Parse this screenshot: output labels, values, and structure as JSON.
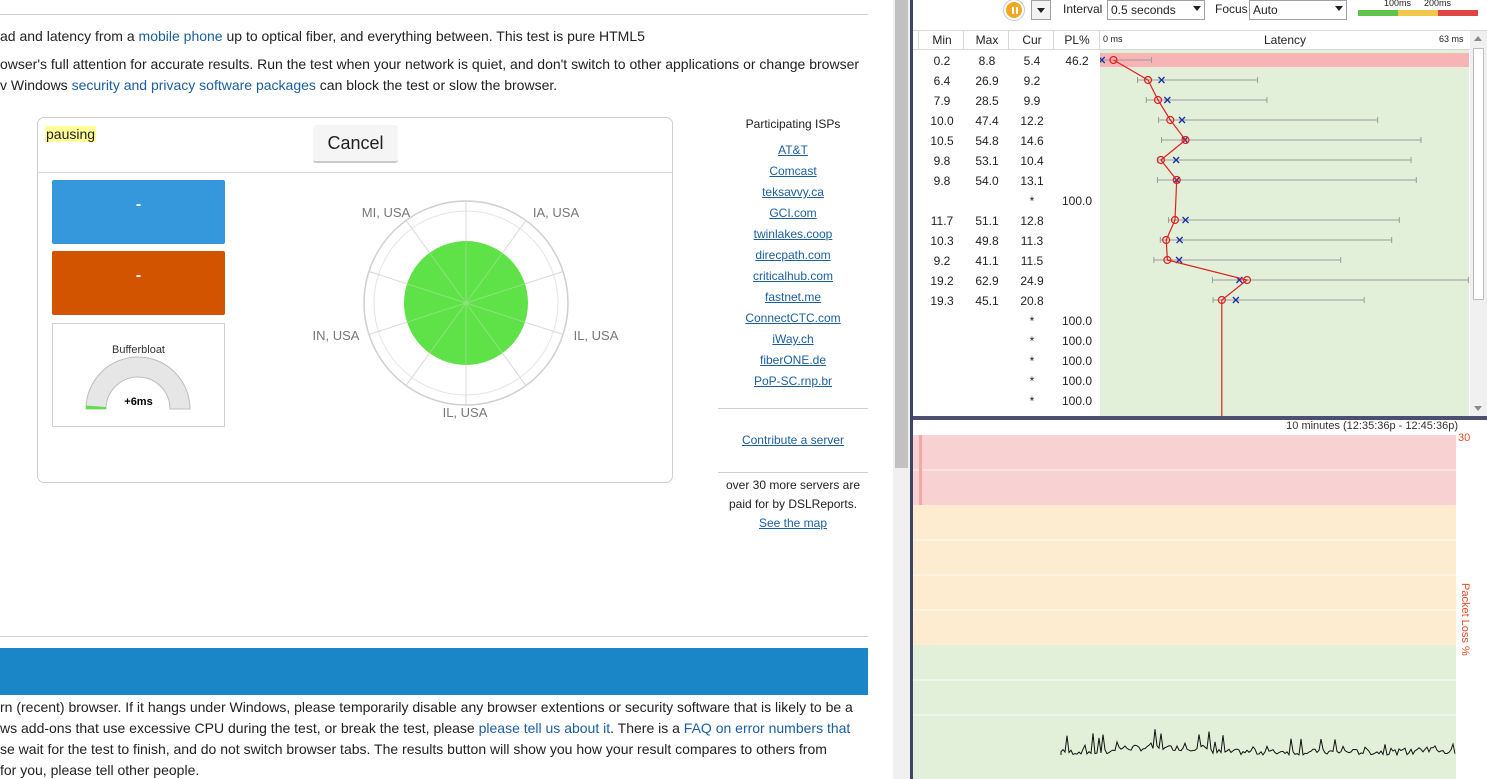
{
  "page": {
    "line1_parts": [
      "ad and latency from a ",
      "mobile phone",
      " up to optical fiber, and everything between. This test is pure HTML5"
    ],
    "line2": "owser's full attention for accurate results. Run the test when your network is quiet, and don't switch to other applications or change browser",
    "line3_parts": [
      "v Windows ",
      "security and privacy software packages",
      " can block the test or slow the browser."
    ],
    "bottom_lines": [
      [
        "rn (recent) browser. If it hangs under Windows, please temporarily disable any browser extentions or security software that is likely to be a"
      ],
      [
        "ws add-ons that use excessive CPU during the test, or break the test, please ",
        "please tell us about it",
        ". There is a ",
        "FAQ on error numbers that"
      ],
      [
        "se wait for the test to finish, and do not switch browser tabs. The results button will show you how your result compares to others from"
      ],
      [
        " for you, please tell other people."
      ]
    ]
  },
  "widget": {
    "status": "pausing",
    "cancel_label": "Cancel",
    "download_value": "-",
    "upload_value": "-",
    "bufferbloat_title": "Bufferbloat",
    "bufferbloat_value": "+6ms",
    "locations": [
      "MI, USA",
      "IA, USA",
      "IN, USA",
      "IL, USA",
      "IL, USA"
    ],
    "colors": {
      "download": "#3598dc",
      "upload": "#d35400",
      "radar_fill": "#5ee248"
    }
  },
  "isps": {
    "title": "Participating ISPs",
    "items": [
      "AT&T",
      "Comcast",
      "teksavvy.ca",
      "GCI.com",
      "twinlakes.coop",
      "direcpath.com",
      "criticalhub.com",
      "fastnet.me",
      "ConnectCTC.com",
      "iWay.ch",
      "fiberONE.de",
      "PoP-SC.rnp.br"
    ],
    "contribute": "Contribute a server",
    "note_lines": [
      "over 30 more servers are",
      "paid for by DSLReports."
    ],
    "see_map": "See the map"
  },
  "monitor": {
    "interval_label": "Interval",
    "interval_value": "0.5 seconds",
    "focus_label": "Focus",
    "focus_value": "Auto",
    "scale_labels": [
      "100ms",
      "200ms"
    ],
    "columns": {
      "min": "Min",
      "max": "Max",
      "cur": "Cur",
      "pl": "PL%",
      "latency": "Latency"
    },
    "axis_min": "0 ms",
    "axis_max": "63 ms",
    "range_label": "10 minutes (12:35:36p - 12:45:36p)",
    "pl_max": "30",
    "pl_axis": "Packet Loss %",
    "rows": [
      {
        "min": "0.2",
        "max": "8.8",
        "cur": "5.4",
        "pl": "46.2",
        "avg": 0.3,
        "cur_v": 2.3
      },
      {
        "min": "6.4",
        "max": "26.9",
        "cur": "9.2",
        "pl": "",
        "avg": 10.5,
        "cur_v": 8.2
      },
      {
        "min": "7.9",
        "max": "28.5",
        "cur": "9.9",
        "pl": "",
        "avg": 11.5,
        "cur_v": 9.9
      },
      {
        "min": "10.0",
        "max": "47.4",
        "cur": "12.2",
        "pl": "",
        "avg": 14.0,
        "cur_v": 12.0
      },
      {
        "min": "10.5",
        "max": "54.8",
        "cur": "14.6",
        "pl": "",
        "avg": 14.5,
        "cur_v": 14.6
      },
      {
        "min": "9.8",
        "max": "53.1",
        "cur": "10.4",
        "pl": "",
        "avg": 13.0,
        "cur_v": 10.4
      },
      {
        "min": "9.8",
        "max": "54.0",
        "cur": "13.1",
        "pl": "",
        "avg": 13.1,
        "cur_v": 13.1
      },
      {
        "min": "",
        "max": "",
        "cur": "*",
        "pl": "100.0",
        "avg": null,
        "cur_v": null
      },
      {
        "min": "11.7",
        "max": "51.1",
        "cur": "12.8",
        "pl": "",
        "avg": 14.6,
        "cur_v": 12.8
      },
      {
        "min": "10.3",
        "max": "49.8",
        "cur": "11.3",
        "pl": "",
        "avg": 13.6,
        "cur_v": 11.3
      },
      {
        "min": "9.2",
        "max": "41.1",
        "cur": "11.5",
        "pl": "",
        "avg": 13.5,
        "cur_v": 11.5
      },
      {
        "min": "19.2",
        "max": "62.9",
        "cur": "24.9",
        "pl": "",
        "avg": 23.8,
        "cur_v": 25.1
      },
      {
        "min": "19.3",
        "max": "45.1",
        "cur": "20.8",
        "pl": "",
        "avg": 23.2,
        "cur_v": 20.8
      },
      {
        "min": "",
        "max": "",
        "cur": "*",
        "pl": "100.0",
        "avg": null,
        "cur_v": null
      },
      {
        "min": "",
        "max": "",
        "cur": "*",
        "pl": "100.0",
        "avg": null,
        "cur_v": null
      },
      {
        "min": "",
        "max": "",
        "cur": "*",
        "pl": "100.0",
        "avg": null,
        "cur_v": null
      },
      {
        "min": "",
        "max": "",
        "cur": "*",
        "pl": "100.0",
        "avg": null,
        "cur_v": null
      },
      {
        "min": "",
        "max": "",
        "cur": "*",
        "pl": "100.0",
        "avg": null,
        "cur_v": null
      }
    ],
    "axis_range_ms": [
      0,
      63
    ],
    "colors": {
      "latency_bg": "#e2f0d9",
      "loss_row": "#f8b4b4",
      "line": "#e02020",
      "avg_marker": "#1a2ea8",
      "band_red": "#f8d2d2",
      "band_yellow": "#fdecd0",
      "band_green": "#e2f0d9"
    }
  }
}
